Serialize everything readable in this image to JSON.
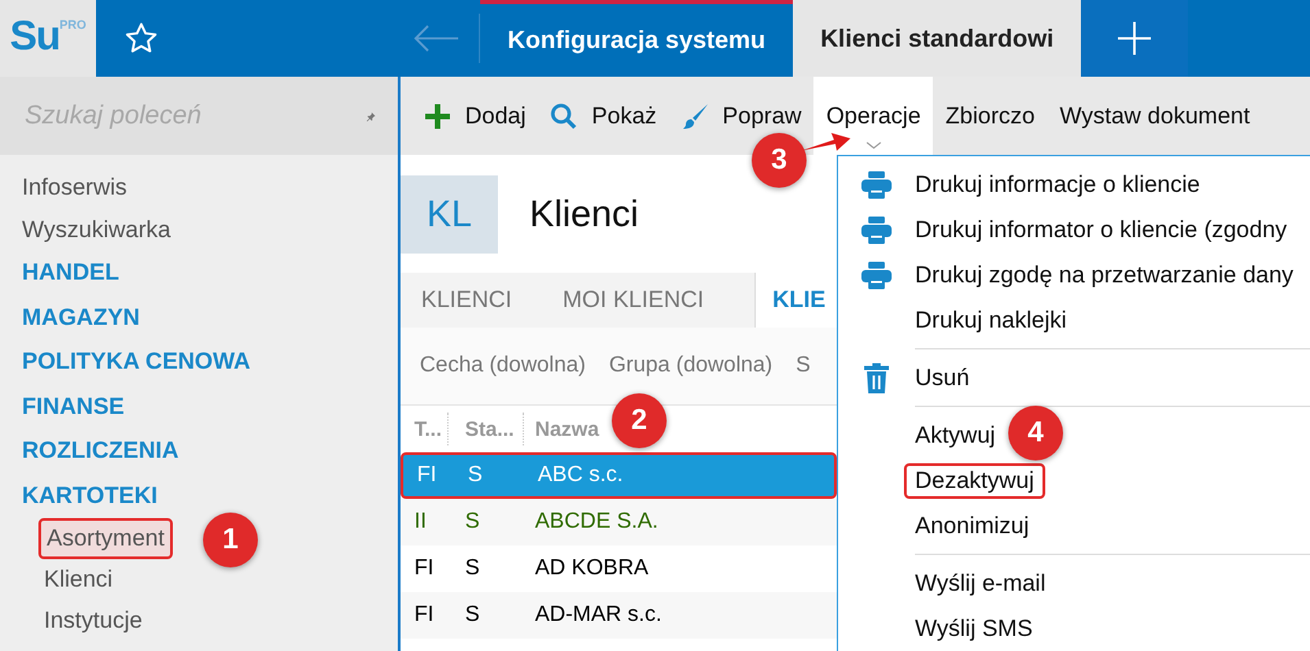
{
  "app": {
    "logo": "Su",
    "edition": "PRO"
  },
  "window_tabs": [
    {
      "label": "Konfiguracja systemu",
      "selected": false,
      "highlighted": true
    },
    {
      "label": "Klienci standardowi",
      "selected": true,
      "highlighted": false
    }
  ],
  "sidebar": {
    "search": {
      "placeholder": "Szukaj poleceń"
    },
    "items": [
      {
        "label": "Infoserwis",
        "kind": "link"
      },
      {
        "label": "Wyszukiwarka",
        "kind": "link"
      },
      {
        "label": "HANDEL",
        "kind": "section"
      },
      {
        "label": "MAGAZYN",
        "kind": "section"
      },
      {
        "label": "POLITYKA CENOWA",
        "kind": "section"
      },
      {
        "label": "FINANSE",
        "kind": "section"
      },
      {
        "label": "ROZLICZENIA",
        "kind": "section"
      },
      {
        "label": "KARTOTEKI",
        "kind": "section",
        "children": [
          {
            "label": "Asortyment",
            "highlighted": true
          },
          {
            "label": "Klienci",
            "highlighted": false
          },
          {
            "label": "Instytucje",
            "highlighted": false
          }
        ]
      }
    ]
  },
  "toolbar": [
    {
      "label": "Dodaj",
      "expanded": false
    },
    {
      "label": "Pokaż",
      "expanded": false
    },
    {
      "label": "Popraw",
      "expanded": false
    },
    {
      "label": "Operacje",
      "expanded": true
    },
    {
      "label": "Zbiorczo",
      "expanded": false
    },
    {
      "label": "Wystaw dokument",
      "expanded": false
    }
  ],
  "view": {
    "badge": "KL",
    "title": "Klienci"
  },
  "view_tabs": [
    {
      "label": "KLIENCI",
      "selected": false
    },
    {
      "label": "MOI KLIENCI",
      "selected": false
    },
    {
      "label": "KLIE",
      "selected": true
    }
  ],
  "filters": [
    "Cecha (dowolna)",
    "Grupa (dowolna)",
    "S"
  ],
  "table": {
    "columns": [
      "T...",
      "Sta...",
      "Nazwa"
    ],
    "rows": [
      {
        "cells": [
          "FI",
          "S",
          "ABC s.c."
        ],
        "selected": true,
        "highlighted": true,
        "color": "#ffffff"
      },
      {
        "cells": [
          "II",
          "S",
          "ABCDE S.A."
        ],
        "selected": false,
        "highlighted": false,
        "color": "#2f6b00"
      },
      {
        "cells": [
          "FI",
          "S",
          "AD KOBRA"
        ],
        "selected": false,
        "highlighted": false,
        "color": "#000000"
      },
      {
        "cells": [
          "FI",
          "S",
          "AD-MAR s.c."
        ],
        "selected": false,
        "highlighted": false,
        "color": "#000000"
      }
    ]
  },
  "menu": [
    {
      "kind": "print",
      "label": "Drukuj informacje o kliencie",
      "highlighted": false
    },
    {
      "kind": "print",
      "label": "Drukuj informator o kliencie (zgodny",
      "highlighted": false
    },
    {
      "kind": "print",
      "label": "Drukuj zgodę na przetwarzanie dany",
      "highlighted": false
    },
    {
      "kind": "plain",
      "label": "Drukuj naklejki",
      "highlighted": false
    },
    {
      "kind": "separator"
    },
    {
      "kind": "delete",
      "label": "Usuń",
      "highlighted": false
    },
    {
      "kind": "separator"
    },
    {
      "kind": "plain",
      "label": "Aktywuj",
      "highlighted": false
    },
    {
      "kind": "plain",
      "label": "Dezaktywuj",
      "highlighted": true
    },
    {
      "kind": "plain",
      "label": "Anonimizuj",
      "highlighted": false
    },
    {
      "kind": "separator"
    },
    {
      "kind": "plain",
      "label": "Wyślij e-mail",
      "highlighted": false
    },
    {
      "kind": "plain",
      "label": "Wyślij SMS",
      "highlighted": false
    }
  ],
  "annotations": [
    {
      "label": "1",
      "arrow": false
    },
    {
      "label": "2",
      "arrow": false
    },
    {
      "label": "3",
      "arrow": true
    },
    {
      "label": "4",
      "arrow": false
    }
  ]
}
